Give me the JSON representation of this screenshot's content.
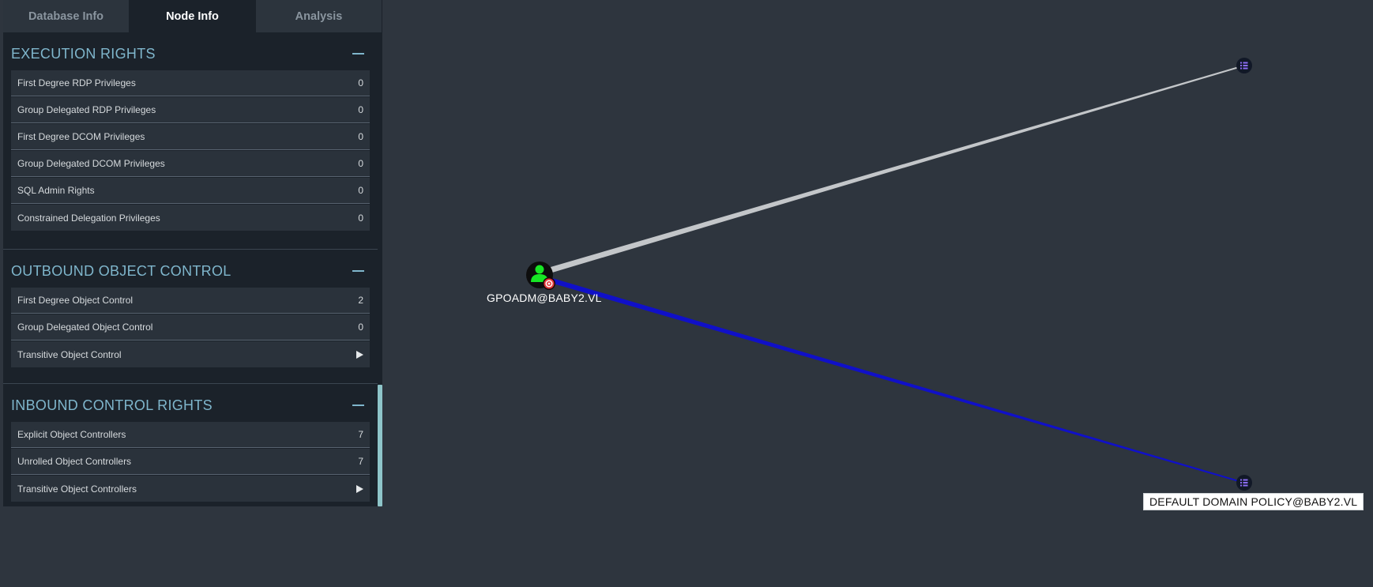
{
  "tabs": [
    {
      "label": "Database Info",
      "active": false
    },
    {
      "label": "Node Info",
      "active": true
    },
    {
      "label": "Analysis",
      "active": false
    }
  ],
  "sections": {
    "execution_rights": {
      "title": "EXECUTION RIGHTS",
      "rows": [
        {
          "label": "First Degree RDP Privileges",
          "value": "0"
        },
        {
          "label": "Group Delegated RDP Privileges",
          "value": "0"
        },
        {
          "label": "First Degree DCOM Privileges",
          "value": "0"
        },
        {
          "label": "Group Delegated DCOM Privileges",
          "value": "0"
        },
        {
          "label": "SQL Admin Rights",
          "value": "0"
        },
        {
          "label": "Constrained Delegation Privileges",
          "value": "0"
        }
      ]
    },
    "outbound_object_control": {
      "title": "OUTBOUND OBJECT CONTROL",
      "rows": [
        {
          "label": "First Degree Object Control",
          "value": "2"
        },
        {
          "label": "Group Delegated Object Control",
          "value": "0"
        },
        {
          "label": "Transitive Object Control",
          "value": "",
          "expand_icon": "play-arrow-icon"
        }
      ]
    },
    "inbound_control_rights": {
      "title": "INBOUND CONTROL RIGHTS",
      "rows": [
        {
          "label": "Explicit Object Controllers",
          "value": "7"
        },
        {
          "label": "Unrolled Object Controllers",
          "value": "7"
        },
        {
          "label": "Transitive Object Controllers",
          "value": "",
          "expand_icon": "play-arrow-icon"
        }
      ]
    }
  },
  "graph": {
    "nodes": {
      "user": {
        "label": "GPOADM@BABY2.VL",
        "icon": "user-icon",
        "badge": "target-icon",
        "color": "#17e625"
      },
      "gpo_top": {
        "label": "",
        "icon": "list-icon",
        "color": "#7a5cf0"
      },
      "gpo_bottom": {
        "label": "DEFAULT DOMAIN POLICY@BABY2.VL",
        "icon": "list-icon",
        "color": "#7a5cf0"
      }
    },
    "edges": [
      {
        "from": "user",
        "to": "gpo_top",
        "color": "#c3c6c9"
      },
      {
        "from": "user",
        "to": "gpo_bottom",
        "color": "#1010c8"
      }
    ]
  },
  "colors": {
    "background": "#2e353e",
    "panel": "#1b222a",
    "section_title": "#7fb6cc",
    "scrollbar": "#8ec5c9"
  }
}
